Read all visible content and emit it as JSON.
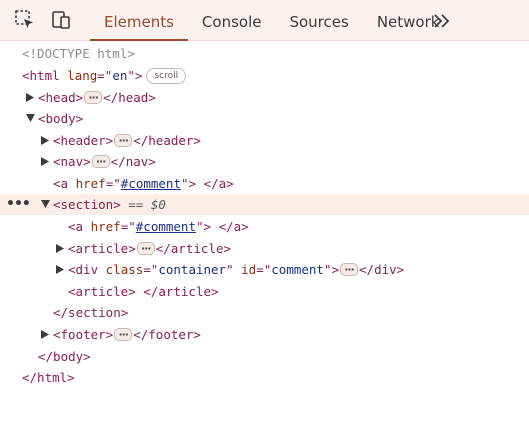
{
  "toolbar": {
    "tabs": [
      "Elements",
      "Console",
      "Sources",
      "Network"
    ],
    "active_tab": "Elements",
    "icons": [
      "inspect-icon",
      "device-toolbar-icon",
      "more-tabs-icon"
    ],
    "accent_color": "#9a4a2e"
  },
  "dom": {
    "doctype": "<!DOCTYPE html>",
    "html_open": "<html",
    "html_attr": "lang",
    "html_attr_eq": "=\"",
    "html_attr_val": "en",
    "html_attr_close": "\">",
    "scroll_badge": "scroll",
    "head_open": "<head>",
    "head_close": "</head>",
    "body_open": "<body>",
    "header_open": "<header>",
    "header_close": "</header>",
    "nav_open": "<nav>",
    "nav_close": "</nav>",
    "a_open": "<a",
    "href_attr": "href",
    "href_eq": "=\"",
    "href_val": "#comment",
    "a_rest": "\">",
    "a_close": "</a>",
    "section_open": "<section>",
    "selected_marker": "== $0",
    "article_open": "<article>",
    "article_close": "</article>",
    "div_open": "<div",
    "class_attr": "class",
    "class_eq": "=\"",
    "class_val": "container",
    "class_close": "\"",
    "id_attr": "id",
    "id_eq": "=\"",
    "id_val": "comment",
    "div_tag_end": "\">",
    "div_close": "</div>",
    "section_close": "</section>",
    "footer_open": "<footer>",
    "footer_close": "</footer>",
    "body_close": "</body>",
    "html_close": "</html>",
    "selected_row_gutter": "•••"
  }
}
